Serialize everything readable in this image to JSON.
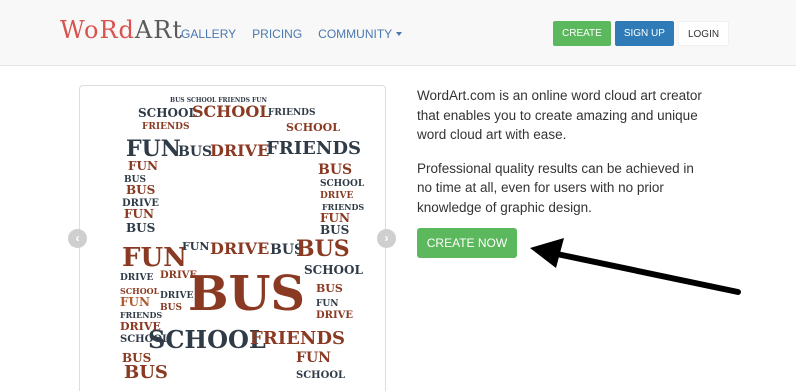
{
  "navbar": {
    "logo": {
      "part1": "WoRd",
      "part2": "ARt"
    },
    "links": [
      {
        "label": "GALLERY"
      },
      {
        "label": "PRICING"
      },
      {
        "label": "COMMUNITY"
      }
    ],
    "create_label": "CREATE",
    "signup_label": "SIGN UP",
    "login_label": "LOGIN"
  },
  "carousel": {
    "prev_icon": "chevron-left-icon",
    "next_icon": "chevron-right-icon",
    "words": [
      "SCHOOL",
      "FRIENDS",
      "FUN",
      "BUS",
      "DRIVE"
    ]
  },
  "intro": {
    "paragraph1": "WordArt.com is an online word cloud art creator that enables you to create amazing and unique word cloud art with ease.",
    "paragraph2": "Professional quality results can be achieved in no time at all, even for users with no prior knowledge of graphic design.",
    "cta_label": "CREATE NOW"
  },
  "colors": {
    "accent_green": "#5cb85c",
    "accent_blue": "#2e7bb8",
    "word_dark": "#2f3b47",
    "word_red": "#8a3a22",
    "word_orange": "#b05a2e"
  }
}
